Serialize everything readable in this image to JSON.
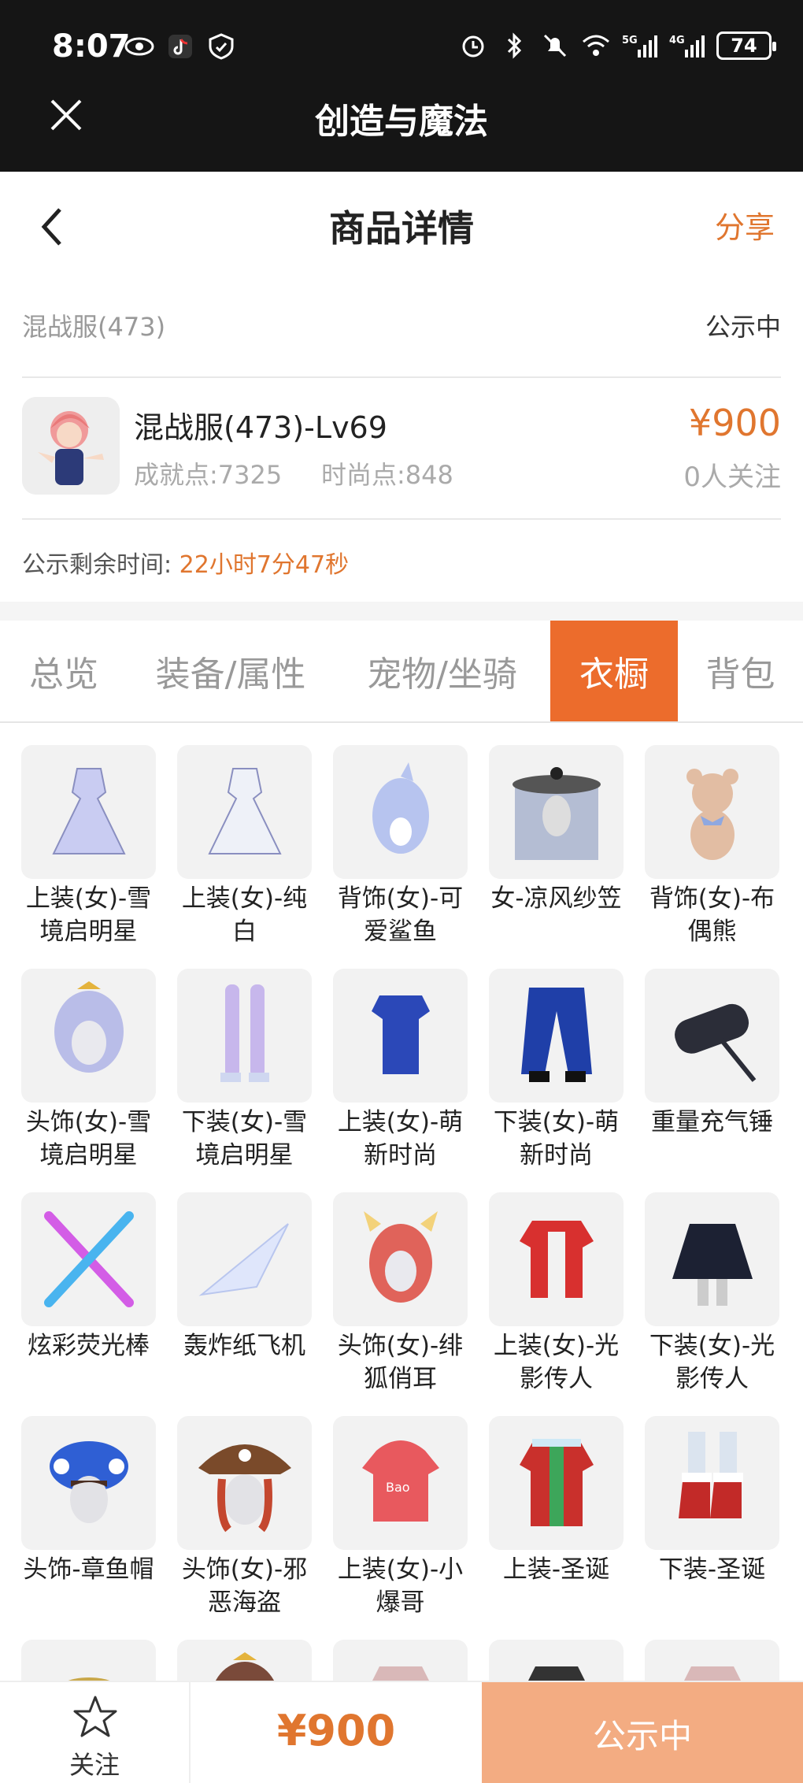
{
  "status_bar": {
    "time": "8:07",
    "battery": "74",
    "network_1": "5G",
    "network_2": "4G"
  },
  "app": {
    "title": "创造与魔法"
  },
  "header": {
    "title": "商品详情",
    "share_label": "分享"
  },
  "server": {
    "name": "混战服(473)",
    "status": "公示中"
  },
  "item": {
    "name": "混战服(473)-Lv69",
    "achievement": "成就点:7325",
    "fashion": "时尚点:848",
    "price": "¥900",
    "followers": "0人关注"
  },
  "remaining": {
    "label": "公示剩余时间:",
    "time": "22小时7分47秒"
  },
  "tabs": [
    {
      "label": "总览",
      "active": false
    },
    {
      "label": "装备/属性",
      "active": false
    },
    {
      "label": "宠物/坐骑",
      "active": false
    },
    {
      "label": "衣橱",
      "active": true
    },
    {
      "label": "背包",
      "active": false
    }
  ],
  "wardrobe": [
    {
      "label": "上装(女)-雪境启明星",
      "icon": "dress-icon",
      "color": "#c9ccf2"
    },
    {
      "label": "上装(女)-纯白",
      "icon": "dress-icon",
      "color": "#eef1f8"
    },
    {
      "label": "背饰(女)-可爱鲨鱼",
      "icon": "shark-icon",
      "color": "#b7c4ef"
    },
    {
      "label": "女-凉风纱笠",
      "icon": "veil-hat-icon",
      "color": "#9aa6c6"
    },
    {
      "label": "背饰(女)-布偶熊",
      "icon": "teddy-bear-icon",
      "color": "#e2bda3"
    },
    {
      "label": "头饰(女)-雪境启明星",
      "icon": "hair-icon",
      "color": "#b9bde8"
    },
    {
      "label": "下装(女)-雪境启明星",
      "icon": "legs-icon",
      "color": "#c7b7ec"
    },
    {
      "label": "上装(女)-萌新时尚",
      "icon": "top-icon",
      "color": "#2b48b8"
    },
    {
      "label": "下装(女)-萌新时尚",
      "icon": "pants-icon",
      "color": "#1f3fa8"
    },
    {
      "label": "重量充气锤",
      "icon": "hammer-icon",
      "color": "#2b2d38"
    },
    {
      "label": "炫彩荧光棒",
      "icon": "glow-sticks-icon",
      "color": "#d35de6"
    },
    {
      "label": "轰炸纸飞机",
      "icon": "paper-plane-icon",
      "color": "#dfe6fb"
    },
    {
      "label": "头饰(女)-绯狐俏耳",
      "icon": "fox-ears-icon",
      "color": "#e0635a"
    },
    {
      "label": "上装(女)-光影传人",
      "icon": "jacket-icon",
      "color": "#d8302f"
    },
    {
      "label": "下装(女)-光影传人",
      "icon": "skirt-icon",
      "color": "#1c2133"
    },
    {
      "label": "头饰-章鱼帽",
      "icon": "octopus-hat-icon",
      "color": "#2f5fd4"
    },
    {
      "label": "头饰(女)-邪恶海盗",
      "icon": "pirate-hat-icon",
      "color": "#7a4a2a"
    },
    {
      "label": "上装(女)-小爆哥",
      "icon": "hoodie-icon",
      "color": "#e8595e"
    },
    {
      "label": "上装-圣诞",
      "icon": "christmas-coat-icon",
      "color": "#c9302c"
    },
    {
      "label": "下装-圣诞",
      "icon": "christmas-boots-icon",
      "color": "#c22a28"
    },
    {
      "label": "",
      "icon": "hat-icon",
      "color": "#c9a84a"
    },
    {
      "label": "",
      "icon": "hair-icon",
      "color": "#7a4a3a"
    },
    {
      "label": "",
      "icon": "top-icon",
      "color": "#d9b8b8"
    },
    {
      "label": "",
      "icon": "top-icon",
      "color": "#333333"
    },
    {
      "label": "",
      "icon": "top-icon",
      "color": "#d9b8b8"
    }
  ],
  "bottom_bar": {
    "follow_label": "关注",
    "price": "¥900",
    "action_label": "公示中"
  },
  "colors": {
    "accent": "#ec6c2c",
    "price": "#e0762f",
    "action_button": "#f3ac82"
  }
}
